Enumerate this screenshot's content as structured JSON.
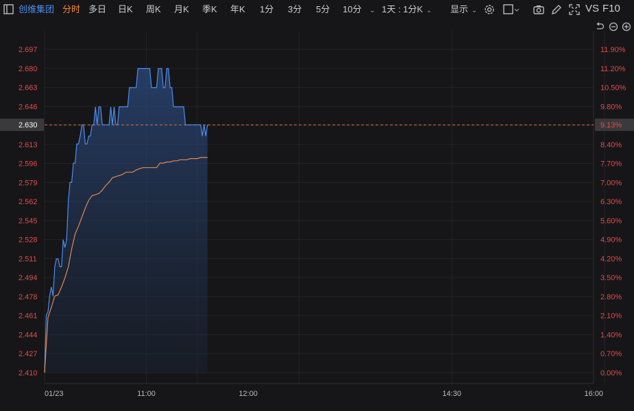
{
  "toolbar": {
    "stock_name": "创维集团",
    "tabs": [
      "分时",
      "多日",
      "日K",
      "周K",
      "月K",
      "季K",
      "年K",
      "1分",
      "3分",
      "5分",
      "10分"
    ],
    "period_select": "1天 : 1分K",
    "display_label": "显示",
    "vs_label": "VS",
    "f10_label": "F10",
    "icons": [
      "sidebar-toggle-icon",
      "settings-icon",
      "square-icon",
      "camera-icon",
      "pencil-icon",
      "fullscreen-icon",
      "undo-icon",
      "zoom-out-icon",
      "zoom-in-icon"
    ]
  },
  "colors": {
    "background": "#161618",
    "price_line": "#4d8ef0",
    "avg_line": "#e8874a",
    "axis_text": "#e24a4a",
    "active_tab": "#ff8a2a",
    "ref_line": "#e06a2a"
  },
  "chart_data": {
    "type": "line",
    "y_ticks": [
      "2.697",
      "2.680",
      "2.663",
      "2.646",
      "2.630",
      "2.613",
      "2.596",
      "2.579",
      "2.562",
      "2.545",
      "2.528",
      "2.511",
      "2.494",
      "2.478",
      "2.461",
      "2.444",
      "2.427",
      "2.410"
    ],
    "pct_ticks": [
      "11.90%",
      "11.20%",
      "10.50%",
      "9.80%",
      "9.13%",
      "8.40%",
      "7.70%",
      "7.00%",
      "6.30%",
      "5.60%",
      "4.90%",
      "4.20%",
      "3.50%",
      "2.80%",
      "2.10%",
      "1.40%",
      "0.70%",
      "0.00%"
    ],
    "x_ticks": [
      "01/23",
      "11:00",
      "12:00",
      "14:30",
      "16:00"
    ],
    "current_price": "2.630",
    "current_pct": "9.13%",
    "ylim": [
      2.41,
      2.697
    ],
    "session_minutes": 330,
    "series": [
      {
        "minutes": [
          0,
          1,
          2,
          3,
          4,
          5,
          6,
          7,
          8,
          9,
          10,
          11,
          12,
          13,
          14,
          15,
          16,
          17,
          18,
          19,
          20,
          21,
          22,
          23,
          24,
          25,
          26,
          27,
          28,
          29,
          30,
          31,
          32,
          33,
          34,
          35,
          36,
          37,
          38,
          39,
          40,
          41,
          42,
          43,
          44,
          45,
          46,
          47,
          48,
          49,
          50,
          51,
          52,
          53,
          54,
          55,
          56,
          57,
          58,
          59,
          60,
          61,
          62,
          63,
          64,
          65,
          66,
          67,
          68,
          69,
          70,
          71,
          72,
          73,
          74,
          75,
          76,
          77,
          78,
          79,
          80,
          81,
          82,
          83,
          84,
          85,
          86,
          87,
          88,
          89,
          90,
          91,
          92,
          93,
          94,
          95,
          96
        ],
        "values": [
          2.41,
          2.461,
          2.464,
          2.478,
          2.486,
          2.478,
          2.504,
          2.511,
          2.511,
          2.504,
          2.504,
          2.528,
          2.521,
          2.528,
          2.562,
          2.579,
          2.579,
          2.596,
          2.596,
          2.613,
          2.613,
          2.62,
          2.63,
          2.63,
          2.613,
          2.613,
          2.62,
          2.62,
          2.63,
          2.63,
          2.646,
          2.63,
          2.646,
          2.646,
          2.63,
          2.63,
          2.63,
          2.63,
          2.63,
          2.646,
          2.63,
          2.646,
          2.63,
          2.63,
          2.646,
          2.646,
          2.646,
          2.646,
          2.646,
          2.646,
          2.663,
          2.663,
          2.663,
          2.663,
          2.663,
          2.68,
          2.68,
          2.68,
          2.68,
          2.68,
          2.68,
          2.68,
          2.68,
          2.663,
          2.663,
          2.663,
          2.663,
          2.68,
          2.68,
          2.68,
          2.663,
          2.663,
          2.68,
          2.68,
          2.663,
          2.663,
          2.646,
          2.646,
          2.646,
          2.646,
          2.646,
          2.646,
          2.646,
          2.63,
          2.63,
          2.63,
          2.63,
          2.63,
          2.63,
          2.63,
          2.63,
          2.63,
          2.63,
          2.62,
          2.63,
          2.62,
          2.63
        ]
      },
      {
        "minutes": [
          0,
          2,
          4,
          6,
          8,
          10,
          12,
          14,
          16,
          18,
          20,
          22,
          24,
          26,
          28,
          30,
          32,
          34,
          36,
          38,
          40,
          42,
          44,
          46,
          48,
          50,
          52,
          54,
          56,
          58,
          60,
          62,
          64,
          66,
          68,
          70,
          72,
          74,
          76,
          78,
          80,
          82,
          84,
          86,
          88,
          90,
          92,
          94,
          96
        ],
        "values": [
          2.41,
          2.459,
          2.468,
          2.478,
          2.479,
          2.486,
          2.494,
          2.504,
          2.52,
          2.533,
          2.54,
          2.548,
          2.556,
          2.563,
          2.567,
          2.568,
          2.569,
          2.572,
          2.576,
          2.579,
          2.583,
          2.584,
          2.585,
          2.586,
          2.588,
          2.588,
          2.588,
          2.59,
          2.591,
          2.592,
          2.592,
          2.592,
          2.592,
          2.592,
          2.596,
          2.596,
          2.597,
          2.597,
          2.598,
          2.598,
          2.599,
          2.599,
          2.599,
          2.6,
          2.6,
          2.6,
          2.601,
          2.601,
          2.601
        ]
      }
    ]
  }
}
